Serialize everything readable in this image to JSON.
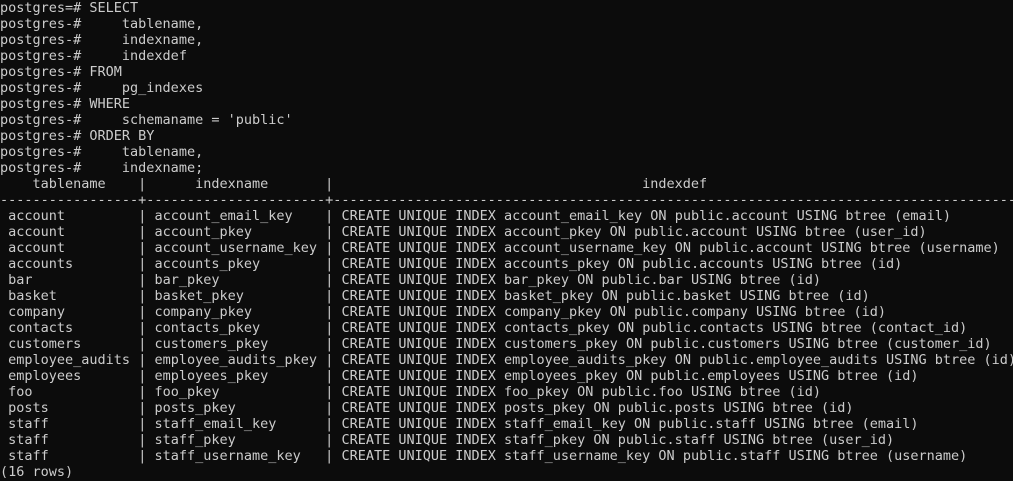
{
  "terminal": {
    "query_lines": [
      {
        "prompt": "postgres=#",
        "text": " SELECT"
      },
      {
        "prompt": "postgres-#",
        "text": "     tablename,"
      },
      {
        "prompt": "postgres-#",
        "text": "     indexname,"
      },
      {
        "prompt": "postgres-#",
        "text": "     indexdef"
      },
      {
        "prompt": "postgres-#",
        "text": " FROM"
      },
      {
        "prompt": "postgres-#",
        "text": "     pg_indexes"
      },
      {
        "prompt": "postgres-#",
        "text": " WHERE"
      },
      {
        "prompt": "postgres-#",
        "text": "     schemaname = 'public'"
      },
      {
        "prompt": "postgres-#",
        "text": " ORDER BY"
      },
      {
        "prompt": "postgres-#",
        "text": "     tablename,"
      },
      {
        "prompt": "postgres-#",
        "text": "     indexname;"
      }
    ],
    "columns": [
      "tablename",
      "indexname",
      "indexdef"
    ],
    "rows": [
      [
        "account",
        "account_email_key",
        "CREATE UNIQUE INDEX account_email_key ON public.account USING btree (email)"
      ],
      [
        "account",
        "account_pkey",
        "CREATE UNIQUE INDEX account_pkey ON public.account USING btree (user_id)"
      ],
      [
        "account",
        "account_username_key",
        "CREATE UNIQUE INDEX account_username_key ON public.account USING btree (username)"
      ],
      [
        "accounts",
        "accounts_pkey",
        "CREATE UNIQUE INDEX accounts_pkey ON public.accounts USING btree (id)"
      ],
      [
        "bar",
        "bar_pkey",
        "CREATE UNIQUE INDEX bar_pkey ON public.bar USING btree (id)"
      ],
      [
        "basket",
        "basket_pkey",
        "CREATE UNIQUE INDEX basket_pkey ON public.basket USING btree (id)"
      ],
      [
        "company",
        "company_pkey",
        "CREATE UNIQUE INDEX company_pkey ON public.company USING btree (id)"
      ],
      [
        "contacts",
        "contacts_pkey",
        "CREATE UNIQUE INDEX contacts_pkey ON public.contacts USING btree (contact_id)"
      ],
      [
        "customers",
        "customers_pkey",
        "CREATE UNIQUE INDEX customers_pkey ON public.customers USING btree (customer_id)"
      ],
      [
        "employee_audits",
        "employee_audits_pkey",
        "CREATE UNIQUE INDEX employee_audits_pkey ON public.employee_audits USING btree (id)"
      ],
      [
        "employees",
        "employees_pkey",
        "CREATE UNIQUE INDEX employees_pkey ON public.employees USING btree (id)"
      ],
      [
        "foo",
        "foo_pkey",
        "CREATE UNIQUE INDEX foo_pkey ON public.foo USING btree (id)"
      ],
      [
        "posts",
        "posts_pkey",
        "CREATE UNIQUE INDEX posts_pkey ON public.posts USING btree (id)"
      ],
      [
        "staff",
        "staff_email_key",
        "CREATE UNIQUE INDEX staff_email_key ON public.staff USING btree (email)"
      ],
      [
        "staff",
        "staff_pkey",
        "CREATE UNIQUE INDEX staff_pkey ON public.staff USING btree (user_id)"
      ],
      [
        "staff",
        "staff_username_key",
        "CREATE UNIQUE INDEX staff_username_key ON public.staff USING btree (username)"
      ]
    ],
    "footer": "(16 rows)",
    "colors": {
      "background": "#0c0c0c",
      "foreground": "#cccccc"
    }
  }
}
